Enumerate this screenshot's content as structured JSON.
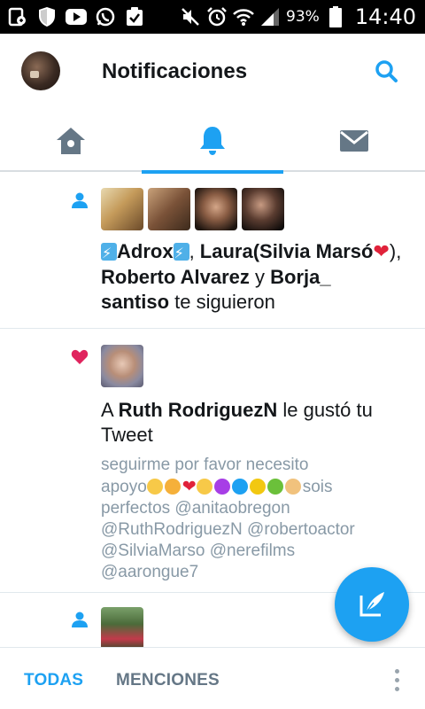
{
  "statusbar": {
    "battery_text": "93%",
    "time": "14:40"
  },
  "header": {
    "title": "Notificaciones"
  },
  "tabs": [
    {
      "name": "home-icon"
    },
    {
      "name": "bell-icon",
      "active": true
    },
    {
      "name": "mail-icon"
    }
  ],
  "notifications": [
    {
      "type": "follow",
      "icon": "person-icon",
      "names": [
        "Adrox",
        "Laura(Silvia Marsó",
        "Roberto Alvarez",
        "Borja_ santiso"
      ],
      "sep1": ", ",
      "sep2": "), ",
      "conj": " y ",
      "suffix": " te siguieron"
    },
    {
      "type": "like",
      "icon": "heart-icon",
      "prefix": "A ",
      "name": "Ruth RodriguezN",
      "action": " le gustó tu Tweet",
      "tweet_line1": "seguirme por favor necesito",
      "tweet_line2_start": "apoyo",
      "tweet_line2_end": "sois",
      "tweet_line3": "perfectos @anitaobregon",
      "tweet_line4": "@RuthRodriguezN @robertoactor",
      "tweet_line5": "@SilviaMarso @nerefilms",
      "tweet_line6": "@aarongue7"
    },
    {
      "type": "follow",
      "icon": "person-icon"
    }
  ],
  "colors": {
    "accent": "#1da1f2",
    "like": "#e0245e",
    "muted": "#8899a6"
  },
  "bottombar": {
    "tab_all": "TODAS",
    "tab_mentions": "MENCIONES"
  }
}
